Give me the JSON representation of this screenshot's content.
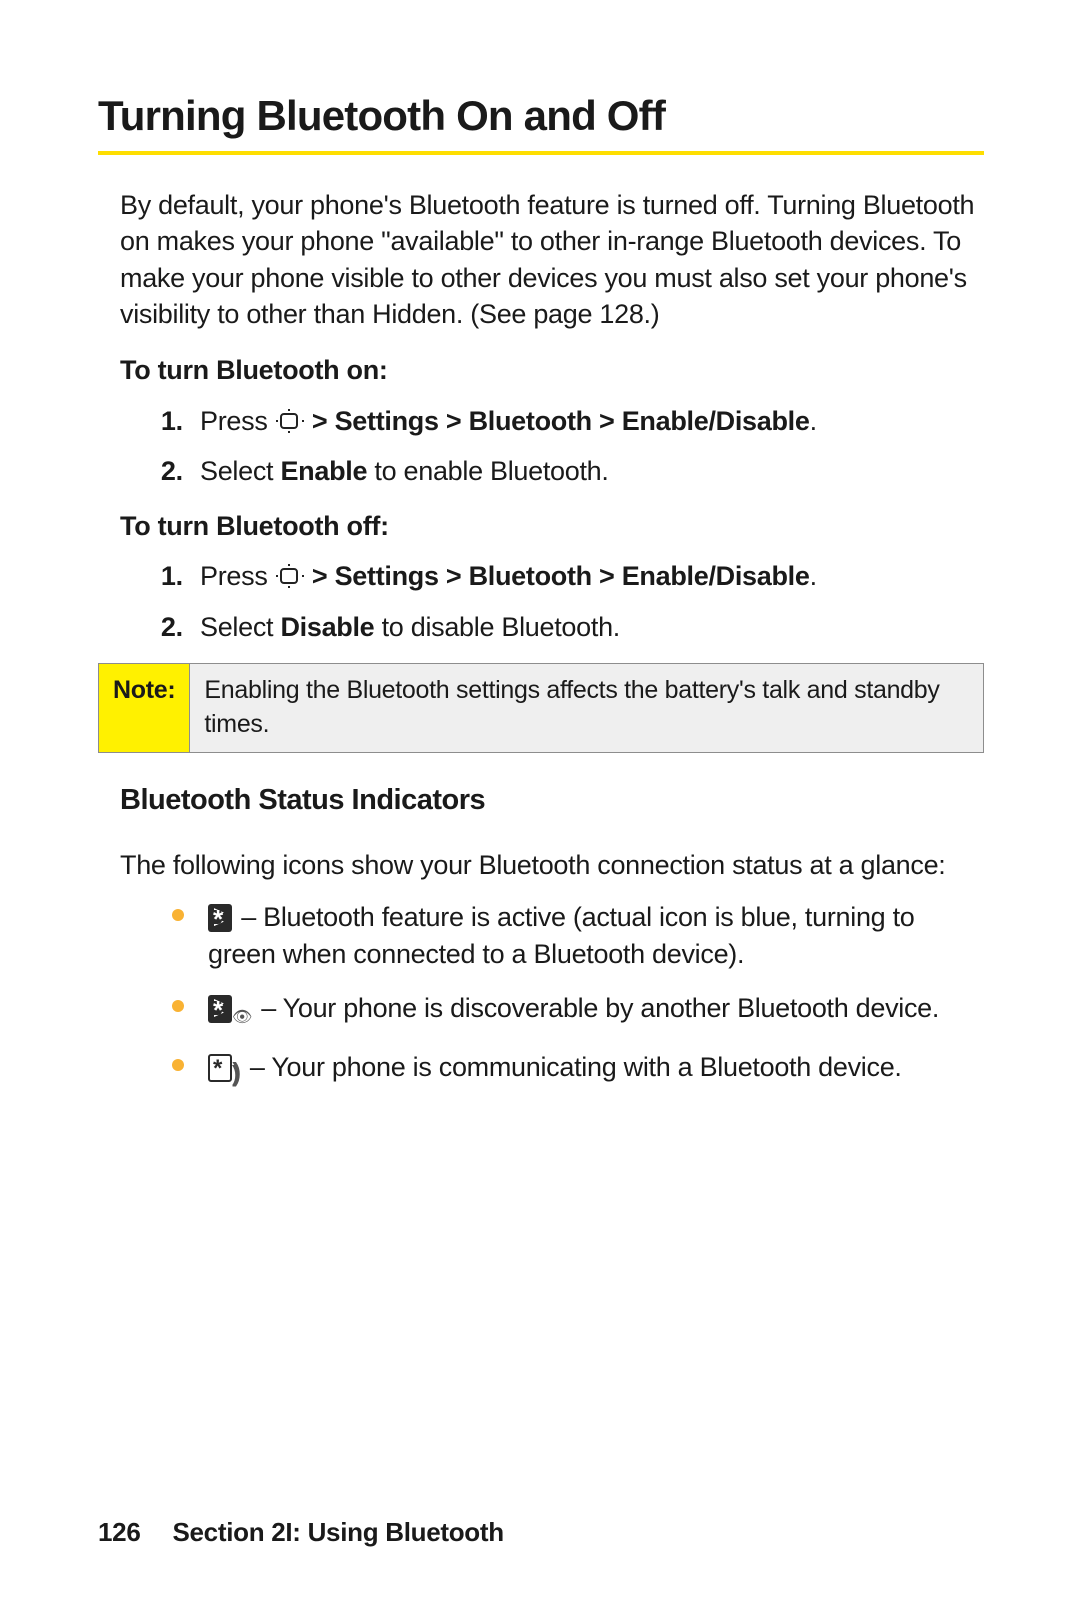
{
  "title": "Turning Bluetooth On and Off",
  "intro": "By default, your phone's Bluetooth feature is turned off. Turning Bluetooth on makes your phone \"available\" to other in-range Bluetooth devices. To make your phone visible to other devices you must also set your phone's visibility to other than Hidden. (See page 128.)",
  "on": {
    "heading": "To turn Bluetooth on:",
    "step1_prefix": "Press ",
    "step1_path": " > Settings > Bluetooth > Enable/Disable",
    "step1_suffix": ".",
    "step2_a": "Select ",
    "step2_bold": "Enable",
    "step2_b": " to enable Bluetooth."
  },
  "off": {
    "heading": "To turn Bluetooth off:",
    "step1_prefix": "Press ",
    "step1_path": " > Settings > Bluetooth > Enable/Disable",
    "step1_suffix": ".",
    "step2_a": "Select ",
    "step2_bold": "Disable",
    "step2_b": " to disable Bluetooth."
  },
  "note": {
    "label": "Note:",
    "body": "Enabling the Bluetooth settings affects the battery's talk and standby times."
  },
  "status": {
    "heading": "Bluetooth Status Indicators",
    "intro": "The following icons show your Bluetooth connection status at a glance:",
    "items": [
      " – Bluetooth feature is active (actual icon is blue, turning to green when connected to a Bluetooth device).",
      " – Your phone is discoverable by another Bluetooth device.",
      " – Your phone is communicating with a Bluetooth device."
    ]
  },
  "footer": {
    "page": "126",
    "section": "Section 2I: Using Bluetooth"
  }
}
